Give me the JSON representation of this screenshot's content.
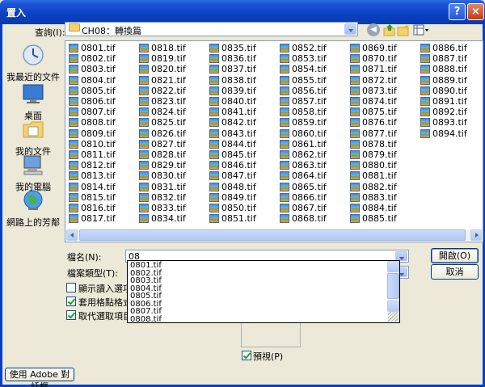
{
  "window": {
    "title": "置入",
    "help_label": "?",
    "close_label": "×"
  },
  "look_in": {
    "label": "查詢(I):",
    "value": "CH08：轉換篇"
  },
  "places": [
    {
      "label": "我最近的文件"
    },
    {
      "label": "桌面"
    },
    {
      "label": "我的文件"
    },
    {
      "label": "我的電腦"
    },
    {
      "label": "網路上的芳鄰"
    }
  ],
  "files": {
    "columns": [
      [
        "0801.tif",
        "0802.tif",
        "0803.tif",
        "0804.tif",
        "0805.tif",
        "0806.tif",
        "0807.tif",
        "0808.tif",
        "0809.tif",
        "0810.tif",
        "0811.tif",
        "0812.tif",
        "0813.tif",
        "0814.tif",
        "0815.tif",
        "0816.tif",
        "0817.tif"
      ],
      [
        "0818.tif",
        "0819.tif",
        "0820.tif",
        "0821.tif",
        "0822.tif",
        "0823.tif",
        "0824.tif",
        "0825.tif",
        "0826.tif",
        "0827.tif",
        "0828.tif",
        "0829.tif",
        "0830.tif",
        "0831.tif",
        "0832.tif",
        "0833.tif",
        "0834.tif"
      ],
      [
        "0835.tif",
        "0836.tif",
        "0837.tif",
        "0838.tif",
        "0839.tif",
        "0840.tif",
        "0841.tif",
        "0842.tif",
        "0843.tif",
        "0844.tif",
        "0845.tif",
        "0846.tif",
        "0847.tif",
        "0848.tif",
        "0849.tif",
        "0850.tif",
        "0851.tif"
      ],
      [
        "0852.tif",
        "0853.tif",
        "0854.tif",
        "0855.tif",
        "0856.tif",
        "0857.tif",
        "0858.tif",
        "0859.tif",
        "0860.tif",
        "0861.tif",
        "0862.tif",
        "0863.tif",
        "0864.tif",
        "0865.tif",
        "0866.tif",
        "0867.tif",
        "0868.tif"
      ],
      [
        "0869.tif",
        "0870.tif",
        "0871.tif",
        "0872.tif",
        "0873.tif",
        "0874.tif",
        "0875.tif",
        "0876.tif",
        "0877.tif",
        "0878.tif",
        "0879.tif",
        "0880.tif",
        "0881.tif",
        "0882.tif",
        "0883.tif",
        "0884.tif",
        "0885.tif"
      ],
      [
        "0886.tif",
        "0887.tif",
        "0888.tif",
        "0889.tif",
        "0890.tif",
        "0891.tif",
        "0892.tif",
        "0893.tif",
        "0894.tif"
      ]
    ]
  },
  "filename": {
    "label": "檔名(N):",
    "value": "08"
  },
  "filetype": {
    "label": "檔案類型(T):"
  },
  "autocomplete": [
    "0801.tif",
    "0802.tif",
    "0803.tif",
    "0804.tif",
    "0805.tif",
    "0806.tif",
    "0807.tif",
    "0808.tif"
  ],
  "buttons": {
    "open": "開啟(O)",
    "cancel": "取消",
    "adobe": "使用 Adobe 對話框"
  },
  "options": [
    {
      "label": "顯示讀入選項(S",
      "checked": false
    },
    {
      "label": "套用格點格式(A",
      "checked": true
    },
    {
      "label": "取代選取項目(M",
      "checked": true
    }
  ],
  "preview": {
    "label": "預視(P)",
    "checked": true
  }
}
